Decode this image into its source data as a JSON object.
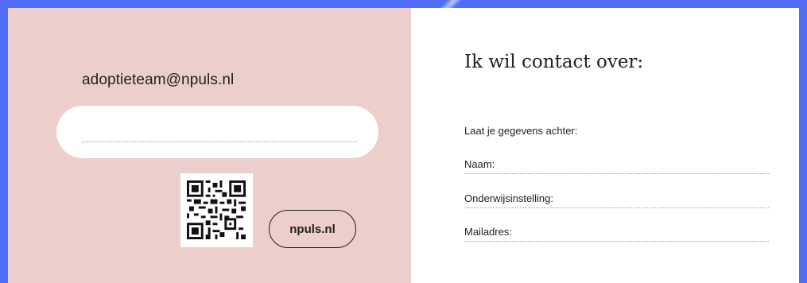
{
  "contact": {
    "email": "adoptieteam@npuls.nl",
    "input_value": "",
    "website_label": "npuls.nl"
  },
  "form": {
    "heading": "Ik wil contact over:",
    "subheading": "Laat je gegevens achter:",
    "fields": [
      {
        "label": "Naam:"
      },
      {
        "label": "Onderwijsinstelling:"
      },
      {
        "label": "Mailadres:"
      }
    ]
  },
  "colors": {
    "background": "#4f6df5",
    "left_panel": "#ecceca",
    "right_panel": "#ffffff",
    "text": "#222222"
  },
  "icons": [
    "qr-code-icon"
  ]
}
